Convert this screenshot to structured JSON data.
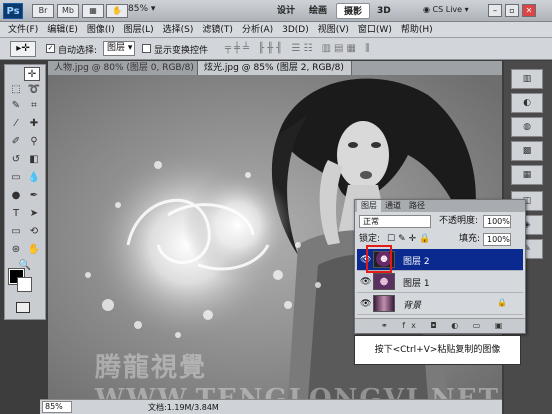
{
  "app": {
    "logo": "Ps",
    "quick_buttons": [
      "Br",
      "Mb"
    ],
    "zoom": "85%",
    "workspaces": [
      "设计",
      "绘画",
      "摄影",
      "3D"
    ],
    "active_workspace": "摄影",
    "cs_live": "CS Live"
  },
  "menu": [
    "文件(F)",
    "编辑(E)",
    "图像(I)",
    "图层(L)",
    "选择(S)",
    "滤镜(T)",
    "分析(A)",
    "3D(D)",
    "视图(V)",
    "窗口(W)",
    "帮助(H)"
  ],
  "options": {
    "auto_select_label": "自动选择:",
    "auto_select_value": "图层",
    "show_transform_label": "显示变换控件"
  },
  "tabs": [
    {
      "label": "人物.jpg @ 80% (图层 0, RGB/8) *",
      "active": false
    },
    {
      "label": "炫光.jpg @ 85% (图层 2, RGB/8) *",
      "active": true
    }
  ],
  "status": {
    "zoom": "85%",
    "doc": "文档:1.19M/3.84M"
  },
  "layers_panel": {
    "tabs": [
      "图层",
      "通道",
      "路径"
    ],
    "blend_mode": "正常",
    "opacity_label": "不透明度:",
    "opacity": "100%",
    "lock_label": "锁定:",
    "fill_label": "填充:",
    "fill": "100%",
    "layers": [
      {
        "name": "图层 2",
        "selected": true
      },
      {
        "name": "图层 1",
        "selected": false
      },
      {
        "name": "背景",
        "selected": false
      }
    ]
  },
  "callout": "按下<Ctrl+V>粘贴复制的图像",
  "watermark": "腾龍視覺 WWW.TENGLONGVI.NET",
  "colors": {
    "selection": "#0a2a8f",
    "highlight": "#e41a1a"
  }
}
